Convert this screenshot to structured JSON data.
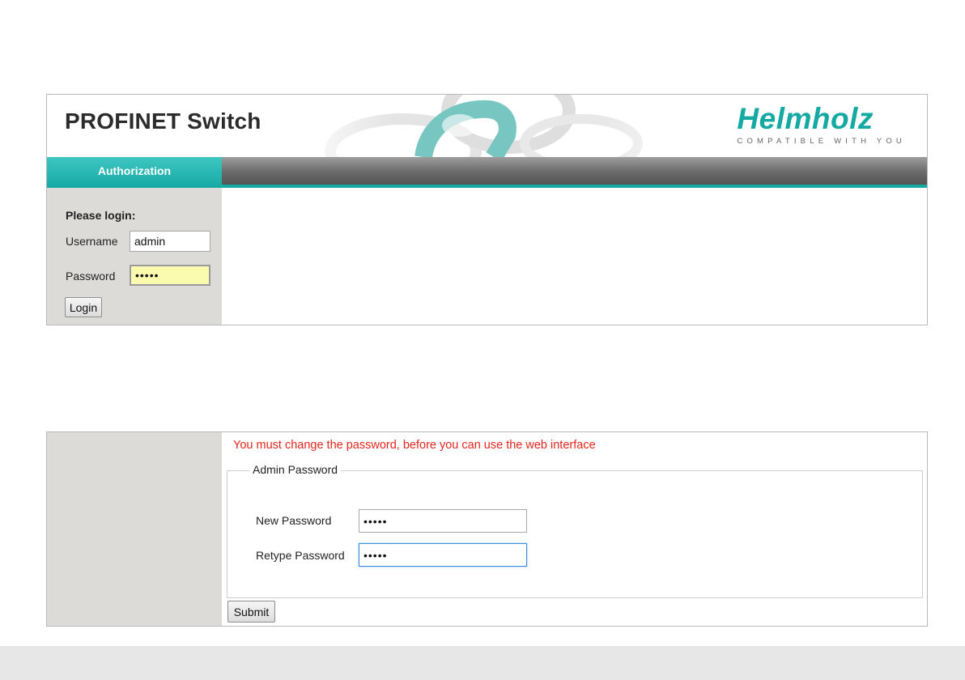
{
  "login_panel": {
    "app_title": "PROFINET Switch",
    "logo": {
      "word": "Helmholz",
      "tagline": "COMPATIBLE WITH YOU"
    },
    "nav": {
      "active_tab": "Authorization"
    },
    "login_form": {
      "heading": "Please login:",
      "username_label": "Username",
      "username_value": "admin",
      "password_label": "Password",
      "password_value": "•••••",
      "login_button": "Login"
    }
  },
  "change_panel": {
    "warning": "You must change the password, before you can use the web interface",
    "legend": "Admin Password",
    "new_password_label": "New Password",
    "new_password_value": "•••••",
    "retype_password_label": "Retype Password",
    "retype_password_value": "•••••",
    "submit_button": "Submit"
  },
  "colors": {
    "accent_teal": "#15a9a4",
    "warning_red": "#e5261e",
    "sidebar_gray": "#dddbd8",
    "autofill_yellow": "#fbfbb0"
  },
  "icons": [
    "chain-artwork",
    "helmholz-logo"
  ]
}
